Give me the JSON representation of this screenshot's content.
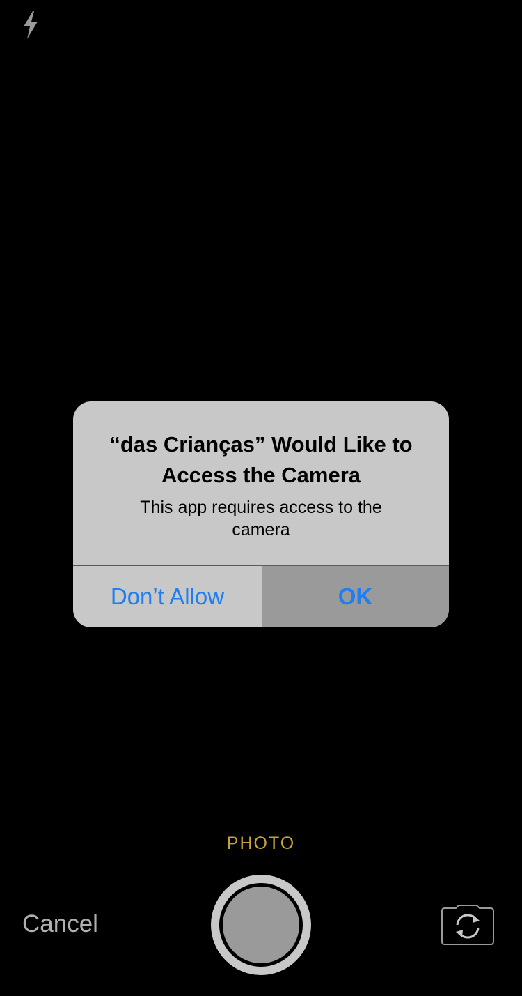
{
  "top_bar": {
    "flash_icon": "flash-icon"
  },
  "alert": {
    "title": "“das Crianças” Would Like to Access the Camera",
    "message": "This app requires access to the camera",
    "dont_allow_label": "Don’t Allow",
    "ok_label": "OK"
  },
  "camera": {
    "mode_label": "PHOTO",
    "cancel_label": "Cancel",
    "shutter_icon": "shutter-button",
    "switch_icon": "switch-camera-icon"
  },
  "colors": {
    "accent_blue": "#1f7ef0",
    "mode_gold": "#c9a13a",
    "alert_bg": "#c8c8c8",
    "alert_highlight": "#9a9a9a"
  }
}
